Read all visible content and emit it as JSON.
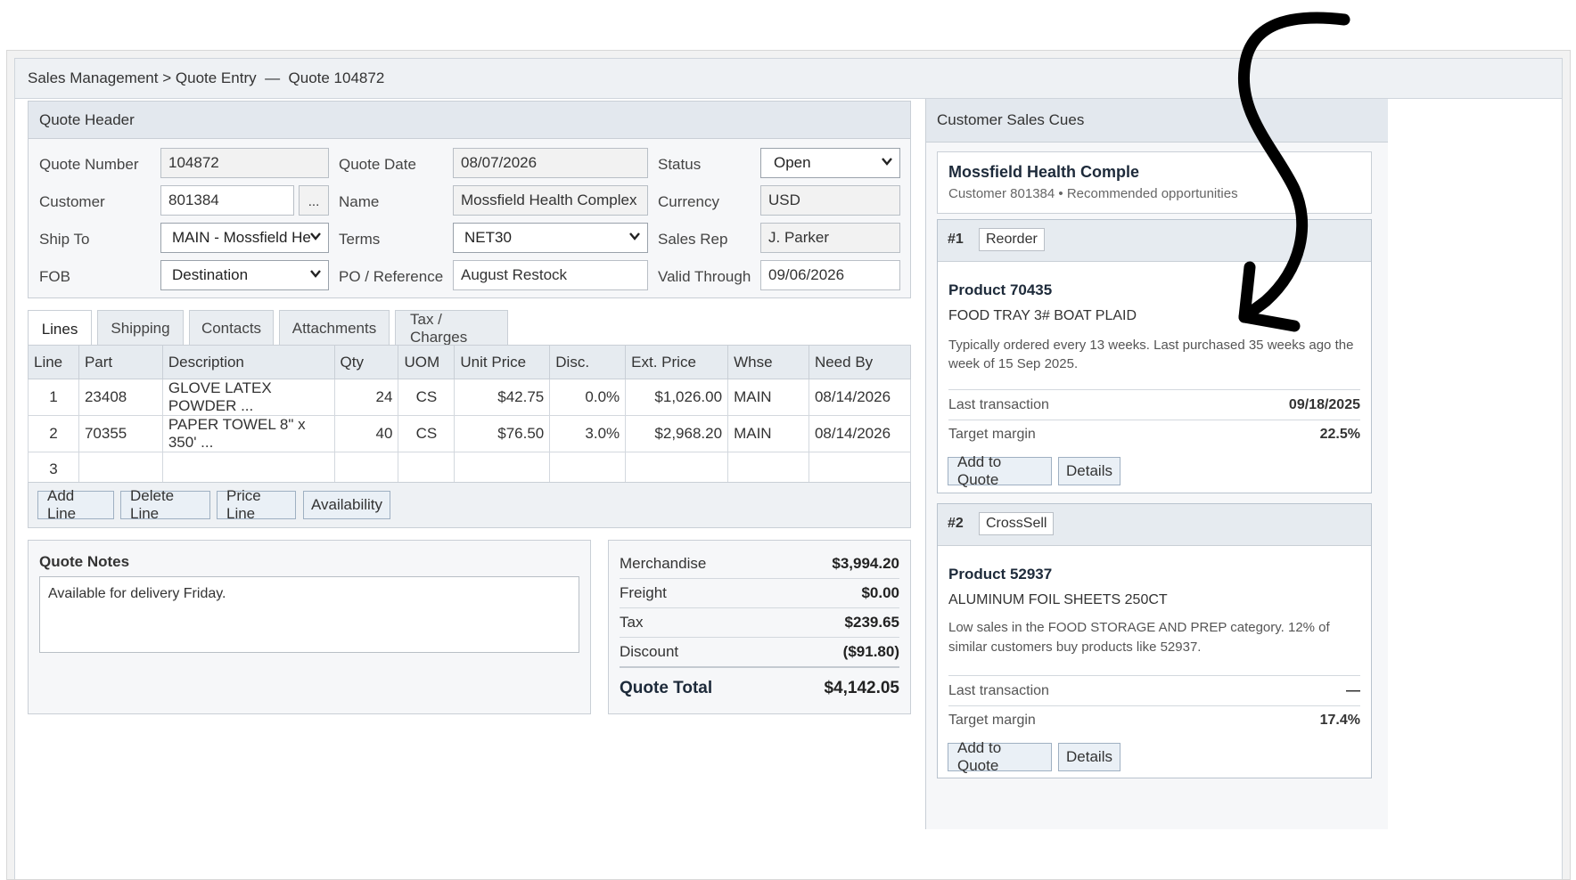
{
  "breadcrumb": {
    "root": "Sales Management",
    "sep": ">",
    "page": "Quote Entry",
    "dash": "—",
    "quote": "Quote 104872"
  },
  "header": {
    "title": "Quote Header",
    "quote_number_label": "Quote Number",
    "quote_number": "104872",
    "customer_label": "Customer",
    "customer": "801384",
    "lookup": "...",
    "ship_to_label": "Ship To",
    "ship_to": "MAIN - Mossfield He",
    "fob_label": "FOB",
    "fob": "Destination",
    "quote_date_label": "Quote Date",
    "quote_date": "08/07/2026",
    "name_label": "Name",
    "name": "Mossfield Health Complex",
    "terms_label": "Terms",
    "terms": "NET30",
    "po_label": "PO / Reference",
    "po": "August Restock",
    "status_label": "Status",
    "status": "Open",
    "currency_label": "Currency",
    "currency": "USD",
    "sales_rep_label": "Sales Rep",
    "sales_rep": "J. Parker",
    "valid_through_label": "Valid Through",
    "valid_through": "09/06/2026"
  },
  "tabs": [
    "Lines",
    "Shipping",
    "Contacts",
    "Attachments",
    "Tax / Charges"
  ],
  "lines": {
    "columns": [
      "Line",
      "Part",
      "Description",
      "Qty",
      "UOM",
      "Unit Price",
      "Disc.",
      "Ext. Price",
      "Whse",
      "Need By"
    ],
    "rows": [
      [
        "1",
        "23408",
        "GLOVE LATEX POWDER ...",
        "24",
        "CS",
        "$42.75",
        "0.0%",
        "$1,026.00",
        "MAIN",
        "08/14/2026"
      ],
      [
        "2",
        "70355",
        "PAPER TOWEL 8\" x 350' ...",
        "40",
        "CS",
        "$76.50",
        "3.0%",
        "$2,968.20",
        "MAIN",
        "08/14/2026"
      ],
      [
        "3",
        "",
        "",
        "",
        "",
        "",
        "",
        "",
        "",
        ""
      ]
    ]
  },
  "line_buttons": {
    "add": "Add Line",
    "delete": "Delete Line",
    "price": "Price Line",
    "availability": "Availability"
  },
  "notes": {
    "title": "Quote Notes",
    "text": "Available for delivery Friday."
  },
  "totals": {
    "merch_label": "Merchandise",
    "merch": "$3,994.20",
    "freight_label": "Freight",
    "freight": "$0.00",
    "tax_label": "Tax",
    "tax": "$239.65",
    "discount_label": "Discount",
    "discount": "($91.80)",
    "total_label": "Quote Total",
    "total": "$4,142.05"
  },
  "cues": {
    "title": "Customer Sales Cues",
    "customer_name": "Mossfield Health Comple",
    "customer_sub": "Customer 801384 • Recommended opportunities",
    "cards": [
      {
        "rank": "#1",
        "kind": "Reorder",
        "product": "Product 70435",
        "desc": "FOOD TRAY 3# BOAT PLAID",
        "reason": "Typically ordered every 13 weeks. Last purchased 35 weeks ago the week of 15 Sep 2025.",
        "last_label": "Last transaction",
        "last": "09/18/2025",
        "margin_label": "Target margin",
        "margin": "22.5%",
        "add": "Add to Quote",
        "details": "Details"
      },
      {
        "rank": "#2",
        "kind": "CrossSell",
        "product": "Product 52937",
        "desc": "ALUMINUM FOIL SHEETS 250CT",
        "reason": "Low sales in the FOOD STORAGE AND PREP category. 12% of similar customers buy products like 52937.",
        "last_label": "Last transaction",
        "last": "—",
        "margin_label": "Target margin",
        "margin": "17.4%",
        "add": "Add to Quote",
        "details": "Details"
      }
    ]
  },
  "colors": {
    "accent": "#e3e8ee",
    "border": "#c9cfd6",
    "arrow": "#000000"
  }
}
